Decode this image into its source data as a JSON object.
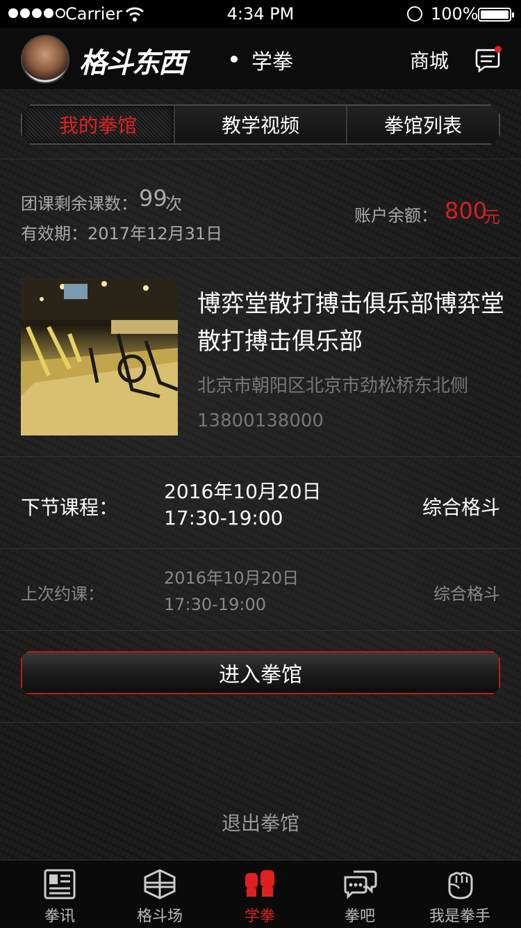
{
  "status_bar": {
    "carrier": "Carrier",
    "time": "4:34 PM",
    "battery": "100%"
  },
  "nav": {
    "logo": "格斗东西",
    "title": "学拳",
    "mall": "商城",
    "has_unread": true
  },
  "segments": [
    {
      "label": "我的拳馆",
      "active": true
    },
    {
      "label": "教学视频",
      "active": false
    },
    {
      "label": "拳馆列表",
      "active": false
    }
  ],
  "account": {
    "remaining_label": "团课剩余课数：",
    "remaining_count": "99",
    "remaining_unit": "次",
    "validity": "有效期：2017年12月31日",
    "balance_label": "账户余额：",
    "balance_amount": "800",
    "balance_unit": "元"
  },
  "gym": {
    "name": "博弈堂散打搏击俱乐部博弈堂散打搏击俱乐部",
    "address": "北京市朝阳区北京市劲松桥东北侧",
    "phone": "13800138000"
  },
  "next_course": {
    "label": "下节课程：",
    "date": "2016年10月20日",
    "time": "17:30-19:00",
    "type": "综合格斗"
  },
  "last_course": {
    "label": "上次约课：",
    "date": "2016年10月20日",
    "time": "17:30-19:00",
    "type": "综合格斗"
  },
  "actions": {
    "enter": "进入拳馆",
    "exit": "退出拳馆"
  },
  "tabs": [
    {
      "label": "拳讯",
      "icon": "newspaper-icon",
      "active": false
    },
    {
      "label": "格斗场",
      "icon": "ring-icon",
      "active": false
    },
    {
      "label": "学拳",
      "icon": "boxing-glove-icon",
      "active": true
    },
    {
      "label": "拳吧",
      "icon": "chat-bubbles-icon",
      "active": false
    },
    {
      "label": "我是拳手",
      "icon": "fist-icon",
      "active": false
    }
  ],
  "colors": {
    "accent": "#e02020",
    "background": "#1a1a1a"
  }
}
